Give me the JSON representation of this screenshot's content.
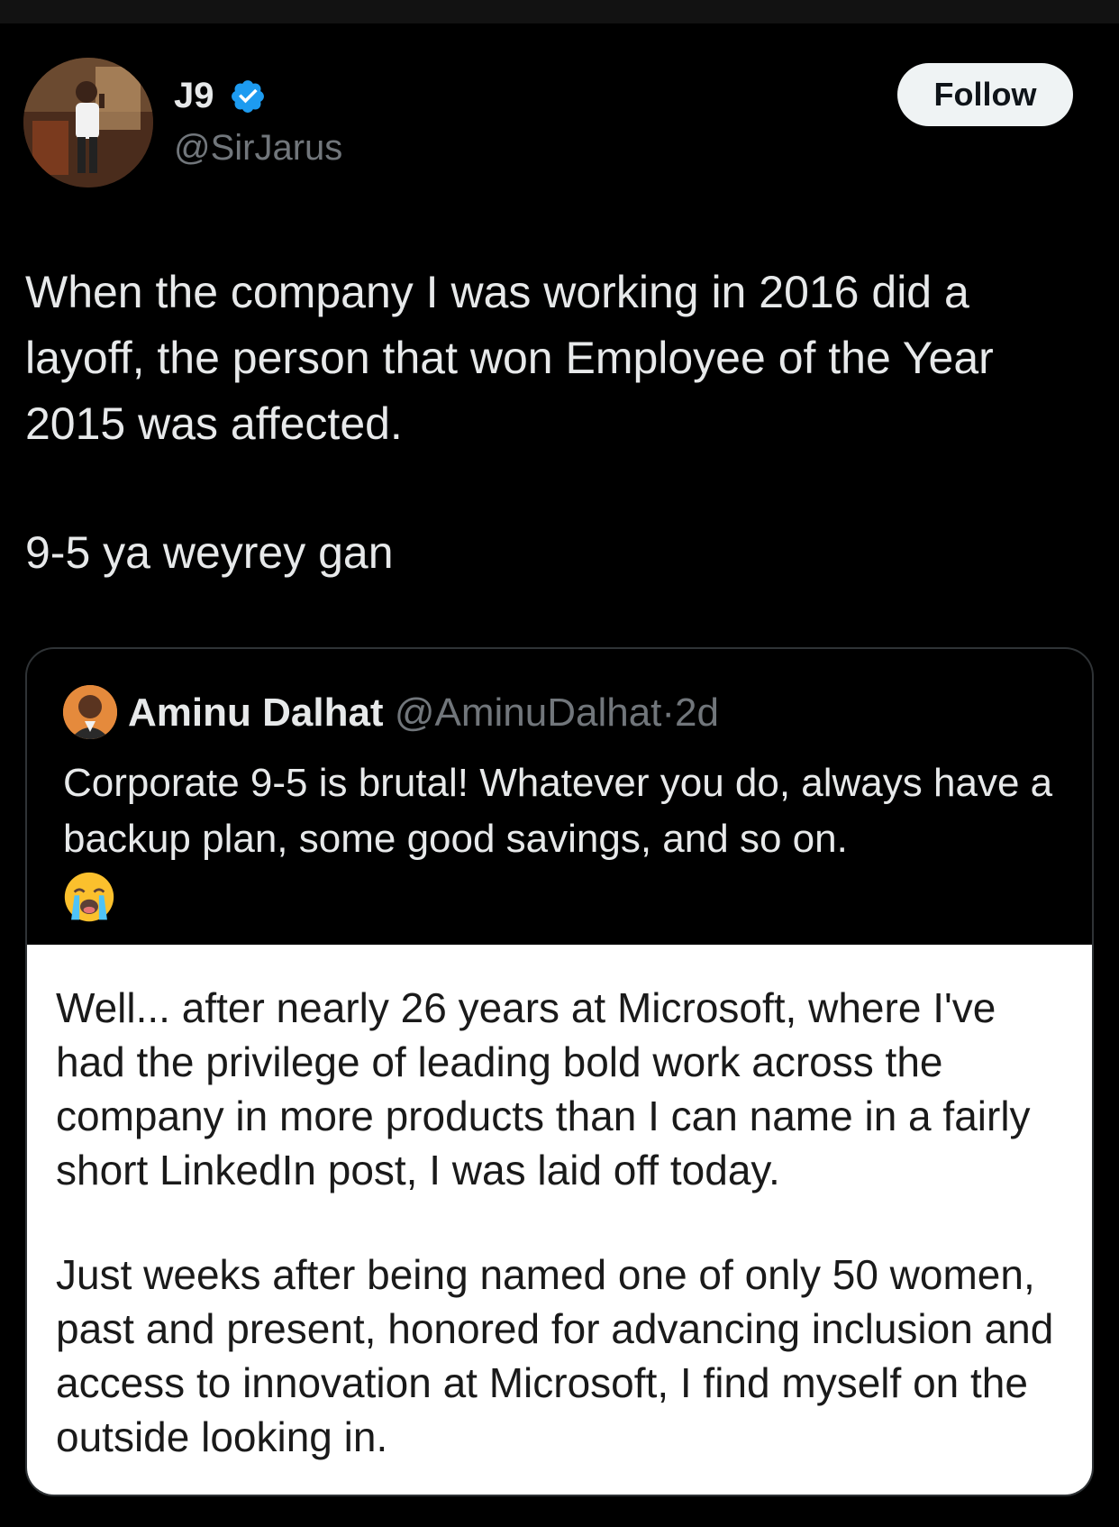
{
  "author": {
    "name": "J9",
    "handle": "@SirJarus",
    "verified": true,
    "follow_label": "Follow"
  },
  "tweet": {
    "paragraph1": "When the company I was working in 2016 did a layoff, the person that won Employee of the Year 2015 was affected.",
    "paragraph2": "9-5 ya weyrey gan"
  },
  "quoted": {
    "name": "Aminu Dalhat",
    "handle": "@AminuDalhat",
    "separator": "·",
    "time": "2d",
    "text": "Corporate 9-5 is brutal! Whatever you do, always have a backup plan, some good savings, and so on.",
    "emoji": "loudly-crying-face-icon",
    "image_text": {
      "paragraph1": "Well... after nearly 26 years at Microsoft, where I've had the privilege of leading bold work across the company in more products than I can name in a fairly short LinkedIn post, I was laid off today.",
      "paragraph2": "Just weeks after being named one of only 50 women, past and present, honored for advancing inclusion and access to innovation at Microsoft, I find myself on the outside looking in."
    }
  },
  "colors": {
    "background": "#000000",
    "text_primary": "#e7e9ea",
    "text_secondary": "#71767b",
    "verified_blue": "#1d9bf0",
    "follow_bg": "#eff3f4",
    "card_border": "#2f3336"
  }
}
